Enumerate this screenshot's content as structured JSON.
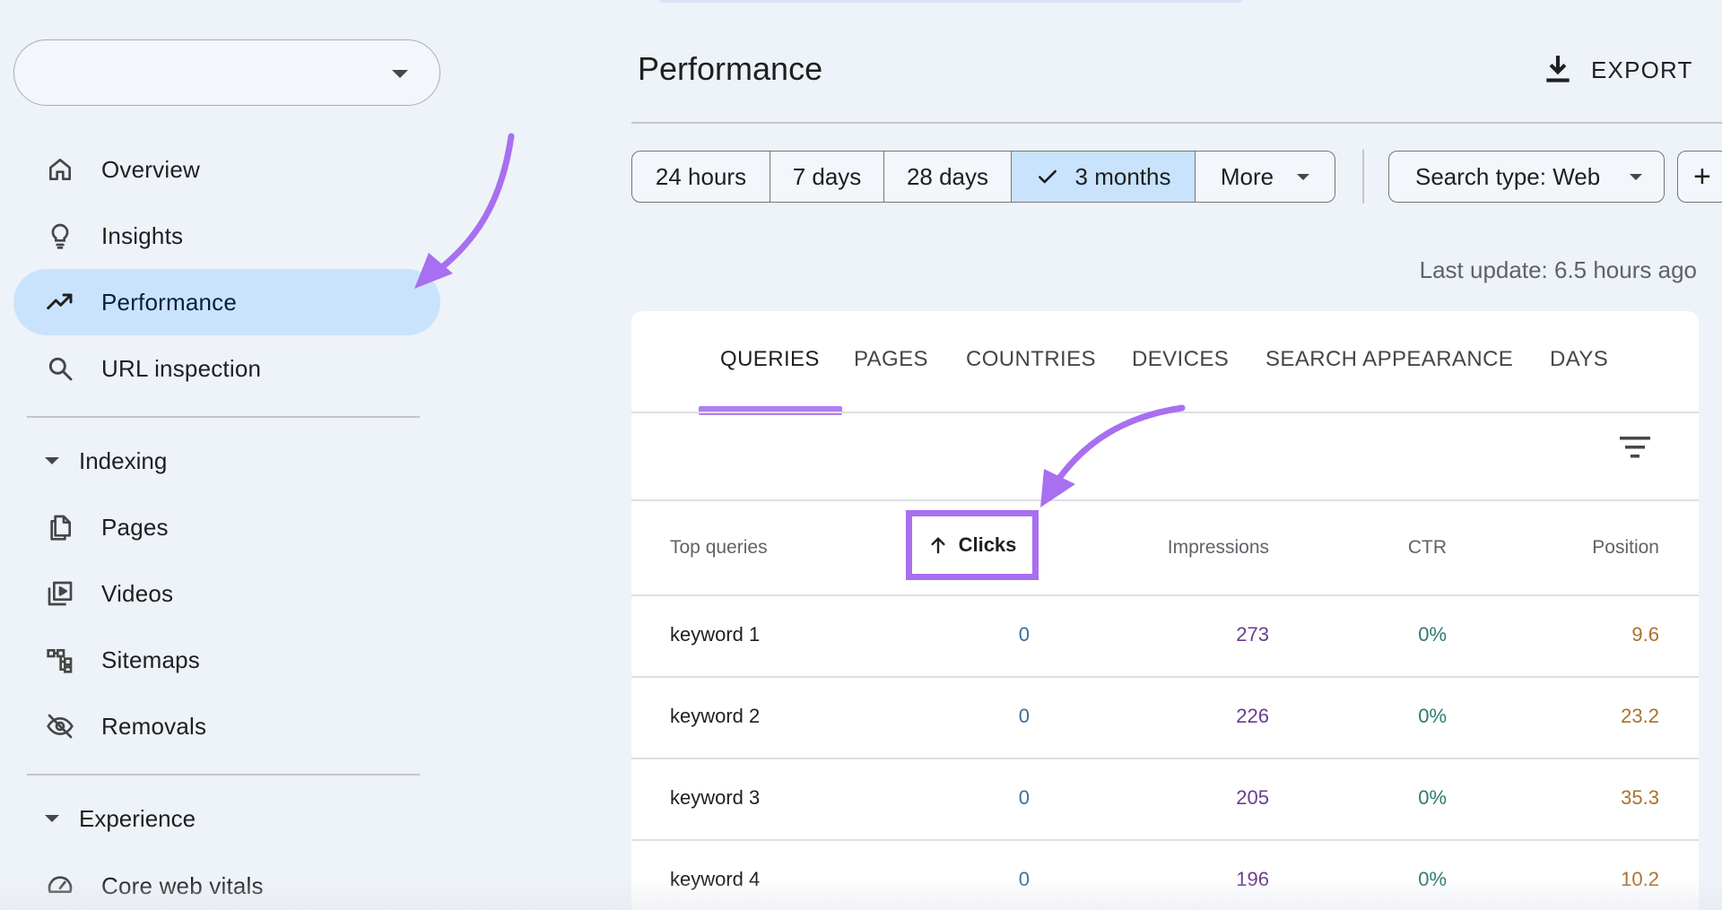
{
  "header": {
    "title": "Performance",
    "export_label": "EXPORT"
  },
  "sidebar": {
    "property_value": "",
    "items": [
      {
        "label": "Overview",
        "icon": "home-icon"
      },
      {
        "label": "Insights",
        "icon": "lightbulb-icon"
      },
      {
        "label": "Performance",
        "icon": "trending-up-icon",
        "active": true
      },
      {
        "label": "URL inspection",
        "icon": "search-icon"
      }
    ],
    "indexing": {
      "header": "Indexing",
      "items": [
        {
          "label": "Pages",
          "icon": "pages-icon"
        },
        {
          "label": "Videos",
          "icon": "videos-icon"
        },
        {
          "label": "Sitemaps",
          "icon": "sitemaps-icon"
        },
        {
          "label": "Removals",
          "icon": "removals-icon"
        }
      ]
    },
    "experience": {
      "header": "Experience",
      "items": [
        {
          "label": "Core web vitals",
          "icon": "gauge-icon"
        }
      ]
    }
  },
  "filters": {
    "ranges": [
      "24 hours",
      "7 days",
      "28 days",
      "3 months",
      "More"
    ],
    "selected_range": "3 months",
    "search_type": "Search type: Web",
    "add_label": "+"
  },
  "last_update": "Last update: 6.5 hours ago",
  "tabs": [
    "QUERIES",
    "PAGES",
    "COUNTRIES",
    "DEVICES",
    "SEARCH APPEARANCE",
    "DAYS"
  ],
  "active_tab": "QUERIES",
  "table": {
    "columns": [
      "Top queries",
      "Clicks",
      "Impressions",
      "CTR",
      "Position"
    ],
    "sorted_column": "Clicks",
    "rows": [
      {
        "query": "keyword 1",
        "clicks": "0",
        "impressions": "273",
        "ctr": "0%",
        "position": "9.6"
      },
      {
        "query": "keyword 2",
        "clicks": "0",
        "impressions": "226",
        "ctr": "0%",
        "position": "23.2"
      },
      {
        "query": "keyword 3",
        "clicks": "0",
        "impressions": "205",
        "ctr": "0%",
        "position": "35.3"
      },
      {
        "query": "keyword 4",
        "clicks": "0",
        "impressions": "196",
        "ctr": "0%",
        "position": "10.2"
      }
    ]
  },
  "colors": {
    "accent_selected": "#c9e3fc",
    "annotation_purple": "#a86ff0",
    "clicks_blue": "#3b6f9e",
    "impressions_purple": "#6a3d8e",
    "ctr_teal": "#2b7a71",
    "position_orange": "#a9722e"
  }
}
